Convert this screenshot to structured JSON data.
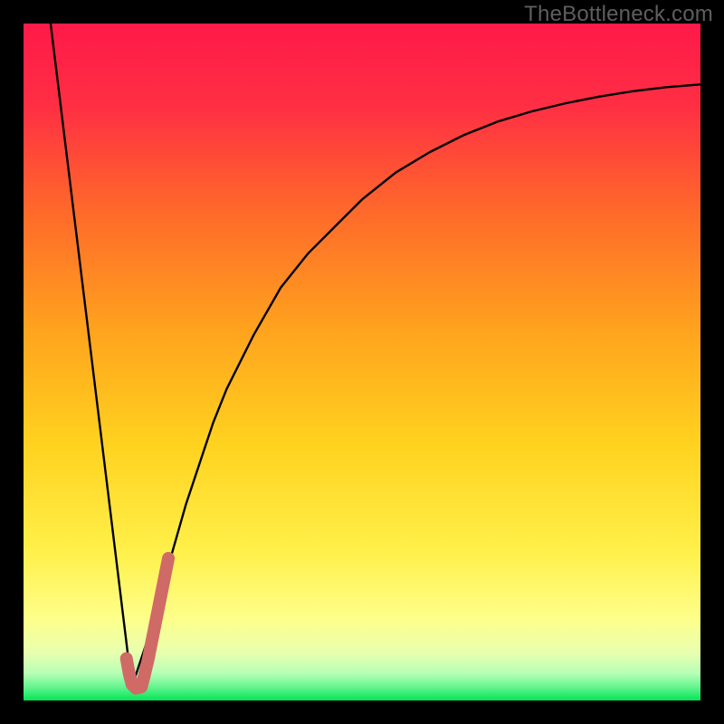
{
  "watermark": "TheBottleneck.com",
  "colors": {
    "frame": "#000000",
    "gradient_top": "#ff1a49",
    "gradient_mid1": "#ff6a2a",
    "gradient_mid2": "#ffd21f",
    "gradient_mid3": "#fff86a",
    "gradient_bottom": "#00e657",
    "curve": "#000000",
    "marker": "#cf6a66"
  },
  "chart_data": {
    "type": "line",
    "title": "",
    "xlabel": "",
    "ylabel": "",
    "xlim": [
      0,
      100
    ],
    "ylim": [
      0,
      100
    ],
    "series": [
      {
        "name": "left-branch",
        "x": [
          4,
          16
        ],
        "values": [
          100,
          2
        ]
      },
      {
        "name": "right-branch",
        "x": [
          16,
          18,
          20,
          22,
          24,
          26,
          28,
          30,
          34,
          38,
          42,
          46,
          50,
          55,
          60,
          65,
          70,
          75,
          80,
          85,
          90,
          95,
          100
        ],
        "values": [
          2,
          8,
          15,
          22,
          29,
          35,
          41,
          46,
          54,
          61,
          66,
          70,
          74,
          78,
          81,
          83.5,
          85.5,
          87,
          88.2,
          89.2,
          90,
          90.6,
          91
        ]
      }
    ],
    "marker": {
      "name": "highlight-j",
      "x": [
        15.2,
        15.6,
        16.0,
        16.6,
        17.4,
        17.8,
        18.4,
        19.0,
        19.6,
        20.2,
        20.8,
        21.4
      ],
      "values": [
        6.2,
        4.0,
        2.4,
        1.8,
        2.0,
        3.5,
        6.0,
        9.0,
        12.0,
        15.0,
        18.0,
        21.0
      ]
    },
    "legend": false,
    "grid": false
  }
}
